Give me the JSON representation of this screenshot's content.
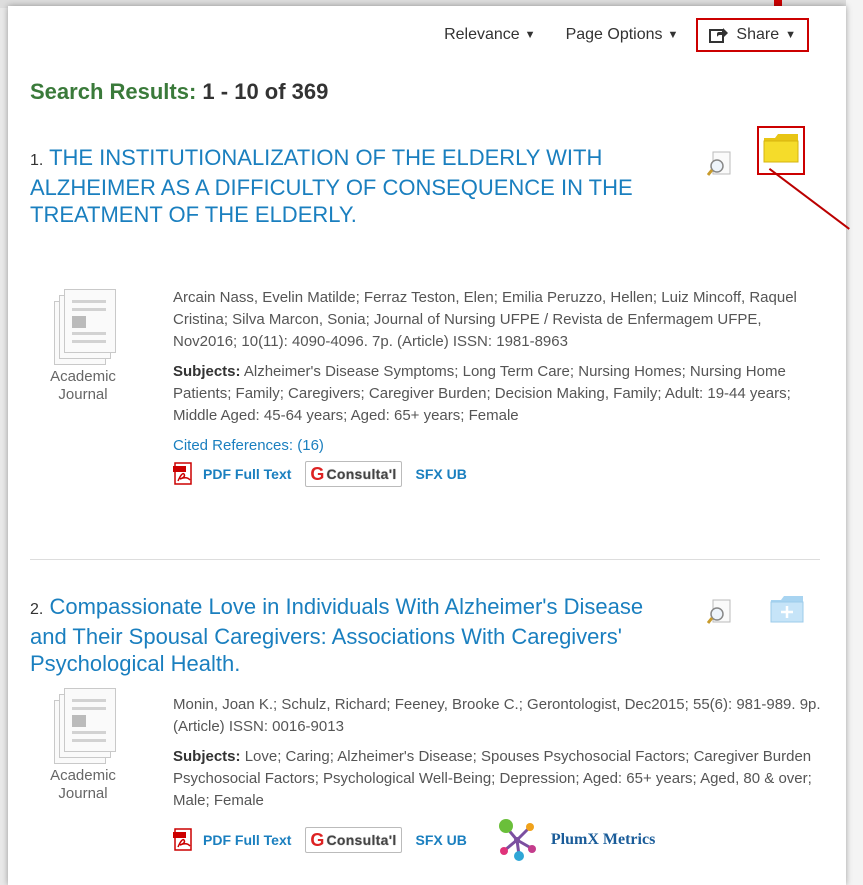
{
  "toolbar": {
    "relevance_label": "Relevance",
    "page_options_label": "Page Options",
    "share_label": "Share"
  },
  "results": {
    "heading_label": "Search Results:",
    "heading_count": "1 - 10 of 369"
  },
  "items": [
    {
      "number": "1.",
      "title": "THE INSTITUTIONALIZATION OF THE ELDERLY WITH ALZHEIMER AS A DIFFICULTY OF CONSEQUENCE IN THE TREATMENT OF THE ELDERLY.",
      "type_line1": "Academic",
      "type_line2": "Journal",
      "citation": "Arcain Nass, Evelin Matilde; Ferraz Teston, Elen; Emilia Peruzzo, Hellen; Luiz Mincoff, Raquel Cristina; Silva Marcon, Sonia; Journal of Nursing UFPE / Revista de Enfermagem UFPE, Nov2016; 10(11): 4090-4096. 7p. (Article) ISSN: 1981-8963",
      "subjects_label": "Subjects:",
      "subjects": "Alzheimer's Disease Symptoms; Long Term Care; Nursing Homes; Nursing Home Patients; Family; Caregivers; Caregiver Burden; Decision Making, Family; Adult: 19-44 years; Middle Aged: 45-64 years; Aged: 65+ years; Female",
      "cited_references": "Cited References: (16)",
      "pdf_label": "PDF Full Text",
      "consulta_label": "Consulta'l",
      "sfx_label": "SFX UB"
    },
    {
      "number": "2.",
      "title": "Compassionate Love in Individuals With Alzheimer's Disease and Their Spousal Caregivers: Associations With Caregivers' Psychological Health.",
      "type_line1": "Academic",
      "type_line2": "Journal",
      "citation": "Monin, Joan K.; Schulz, Richard; Feeney, Brooke C.; Gerontologist, Dec2015; 55(6): 981-989. 9p. (Article) ISSN: 0016-9013",
      "subjects_label": "Subjects:",
      "subjects": "Love; Caring; Alzheimer's Disease; Spouses Psychosocial Factors; Caregiver Burden Psychosocial Factors; Psychological Well-Being; Depression; Aged: 65+ years; Aged, 80 & over; Male; Female",
      "pdf_label": "PDF Full Text",
      "consulta_label": "Consulta'l",
      "sfx_label": "SFX UB",
      "plumx_label": "PlumX Metrics"
    }
  ],
  "colors": {
    "link_blue": "#1a7fbf",
    "heading_green": "#3a7a3a",
    "highlight_red": "#cc0000",
    "folder_yellow": "#f2d31b"
  }
}
